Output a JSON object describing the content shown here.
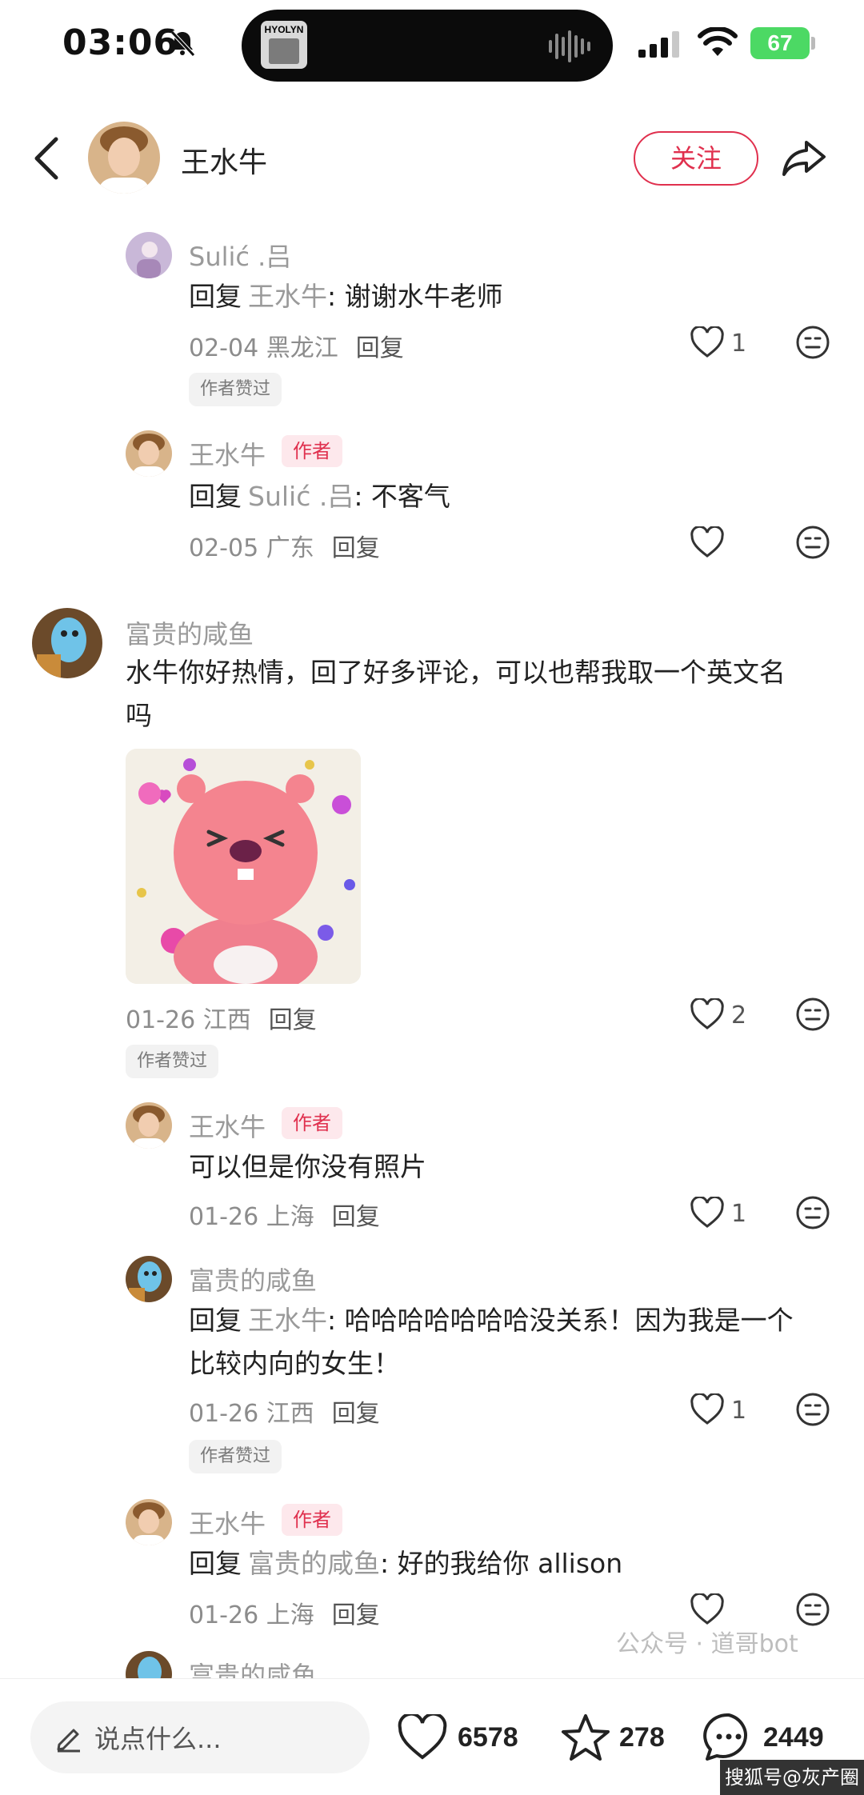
{
  "status_bar": {
    "time": "03:06",
    "island_thumb_label": "HYOLYN",
    "battery": "67"
  },
  "header": {
    "name": "王水牛",
    "follow_label": "关注"
  },
  "comments": [
    {
      "nick": "Sulić .吕",
      "reply_prefix": "回复",
      "reply_to": "王水牛",
      "body": ": 谢谢水牛老师",
      "date_loc": "02-04 黑龙江",
      "reply_label": "回复",
      "likes": "1",
      "badge": "作者赞过"
    },
    {
      "nick": "王水牛",
      "author_tag": "作者",
      "reply_prefix": "回复",
      "reply_to": "Sulić .吕",
      "body": ": 不客气",
      "date_loc": "02-05 广东",
      "reply_label": "回复"
    },
    {
      "nick": "富贵的咸鱼",
      "body_line1": "水牛你好热情，回了好多评论，可以也帮我取一个英文名",
      "body_line2": "吗",
      "date_loc": "01-26 江西",
      "reply_label": "回复",
      "likes": "2",
      "badge": "作者赞过"
    },
    {
      "nick": "王水牛",
      "author_tag": "作者",
      "body": "可以但是你没有照片",
      "date_loc": "01-26 上海",
      "reply_label": "回复",
      "likes": "1"
    },
    {
      "nick": "富贵的咸鱼",
      "reply_prefix": "回复",
      "reply_to": "王水牛",
      "body_line1": ": 哈哈哈哈哈哈哈没关系！因为我是一个",
      "body_line2": "比较内向的女生！",
      "date_loc": "01-26 江西",
      "reply_label": "回复",
      "likes": "1",
      "badge": "作者赞过"
    },
    {
      "nick": "王水牛",
      "author_tag": "作者",
      "reply_prefix": "回复",
      "reply_to": "富贵的咸鱼",
      "body": ": 好的我给你 allison",
      "date_loc": "01-26 上海",
      "reply_label": "回复"
    },
    {
      "nick": "富贵的咸鱼"
    }
  ],
  "bottom_bar": {
    "input_placeholder": "说点什么...",
    "likes": "6578",
    "stars": "278",
    "comments": "2449"
  },
  "watermark": "公众号 · 道哥bot",
  "watermark2": "搜狐号@灰产圈",
  "colors": {
    "accent": "#e0304e",
    "author_tag_bg": "#fde8ec",
    "secondary_text": "#9a9a9a"
  }
}
